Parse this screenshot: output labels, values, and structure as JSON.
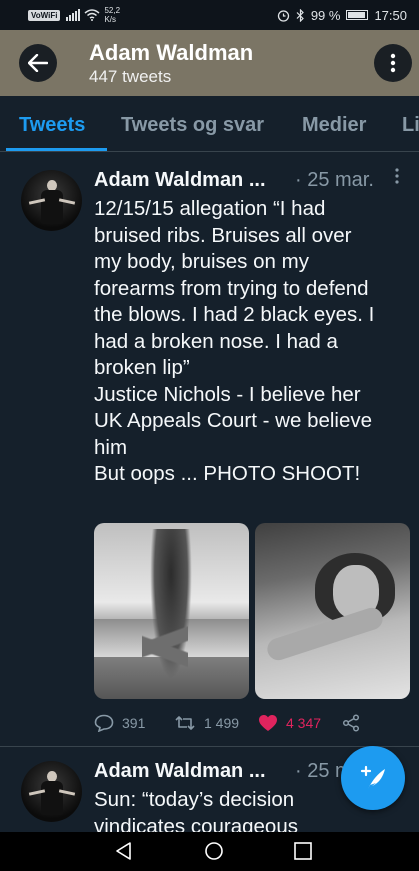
{
  "status_bar": {
    "wifi_label": "VoWiFi",
    "speed_value": "52,2",
    "speed_unit": "K/s",
    "battery": "99 %",
    "time": "17:50"
  },
  "header": {
    "title": "Adam Waldman",
    "subtitle": "447 tweets",
    "bg_color": "#7b7565"
  },
  "tabs": [
    {
      "label": "Tweets",
      "active": true
    },
    {
      "label": "Tweets og svar",
      "active": false
    },
    {
      "label": "Medier",
      "active": false
    },
    {
      "label": "Li",
      "active": false
    }
  ],
  "tweets": [
    {
      "author": "Adam Waldman ...",
      "date": "· 25 mar.",
      "lines": [
        "12/15/15 allegation “I had",
        "bruised ribs. Bruises all over",
        "my body, bruises on my",
        "forearms from trying to defend",
        "the blows. I had 2 black eyes. I",
        "had a broken nose. I had a",
        "broken lip”",
        "Justice Nichols - I believe her",
        "UK Appeals Court - we believe",
        "him",
        "But oops ... PHOTO SHOOT!"
      ],
      "replies": "391",
      "retweets": "1 499",
      "likes": "4 347"
    },
    {
      "author": "Adam Waldman ...",
      "date": "· 25 m",
      "lines": [
        "Sun: “today’s decision",
        "vindicates courageous"
      ]
    }
  ],
  "colors": {
    "accent": "#1d9bf0",
    "like": "#e0245e",
    "background": "#15202b",
    "muted": "#8899a6"
  },
  "icons": {
    "back": "arrow-left-icon",
    "more": "vertical-dots-icon",
    "reply": "speech-bubble-icon",
    "retweet": "retweet-icon",
    "like": "heart-icon",
    "share": "share-icon",
    "compose": "feather-plus-icon"
  }
}
